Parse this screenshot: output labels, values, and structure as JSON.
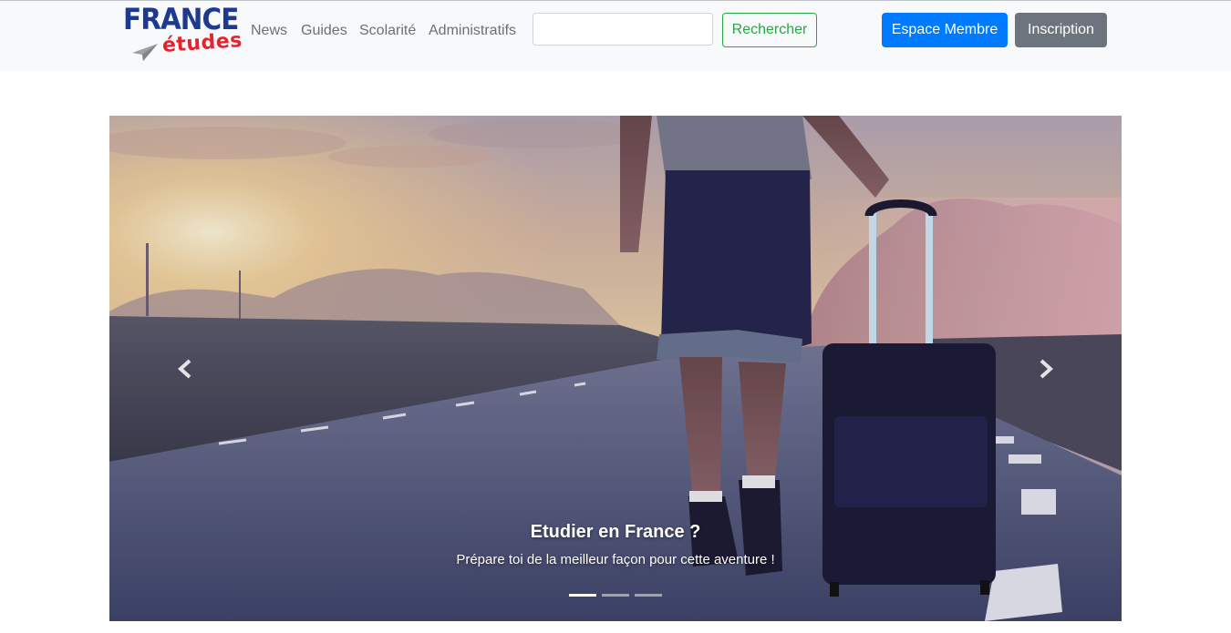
{
  "brand": {
    "logo_top": "FRANCE",
    "logo_bottom": "études",
    "colors": {
      "blue": "#1d3a8f",
      "red": "#e5232d"
    }
  },
  "nav": {
    "links": [
      "News",
      "Guides",
      "Scolarité",
      "Administratifs"
    ],
    "search": {
      "value": "",
      "placeholder": ""
    },
    "search_button": "Rechercher",
    "member_button": "Espace Membre",
    "signup_button": "Inscription"
  },
  "carousel": {
    "caption_title": "Etudier en France ?",
    "caption_text": "Prépare toi de la meilleur façon pour cette aventure !",
    "slides_count": 3,
    "active_slide": 1,
    "prev_icon": "chevron-left-icon",
    "next_icon": "chevron-right-icon"
  },
  "colors": {
    "primary": "#007bff",
    "success": "#28a745",
    "secondary": "#6c757d",
    "navbar_bg": "#f8f9fa"
  }
}
